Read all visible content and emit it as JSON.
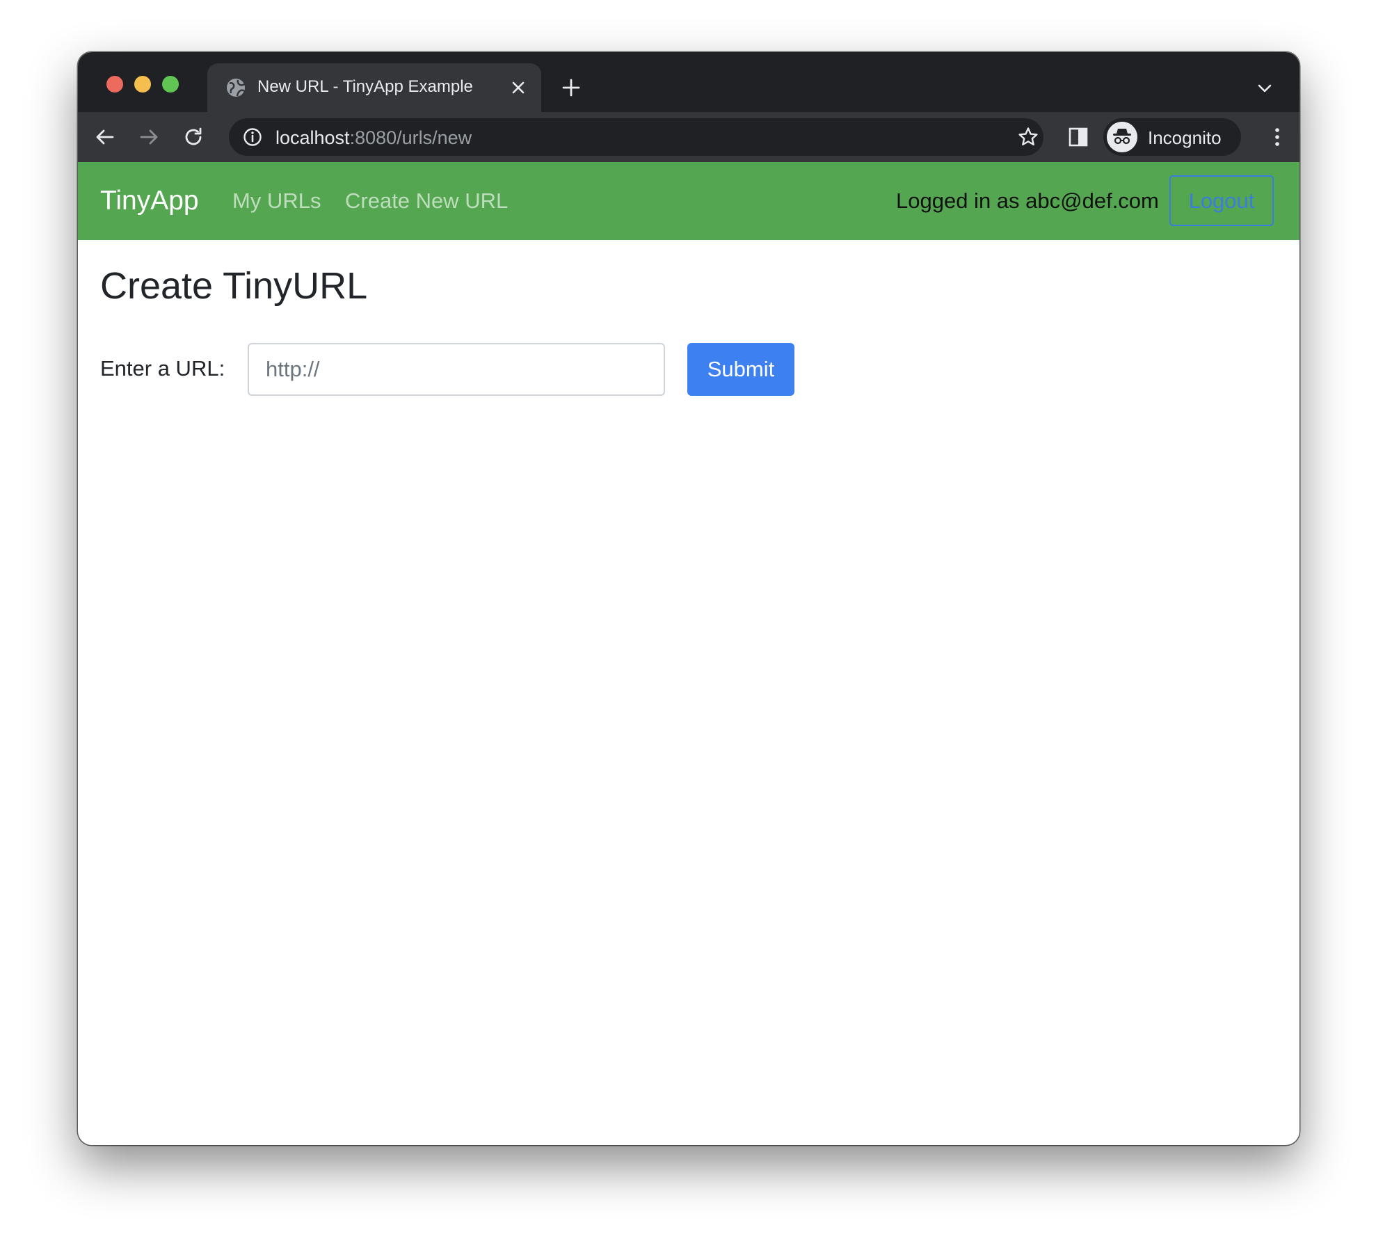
{
  "browser": {
    "tab": {
      "title": "New URL - TinyApp Example"
    },
    "address_bar": {
      "host": "localhost",
      "path": ":8080/urls/new"
    },
    "profile": {
      "label": "Incognito"
    }
  },
  "navbar": {
    "brand": "TinyApp",
    "links": [
      {
        "label": "My URLs"
      },
      {
        "label": "Create New URL"
      }
    ],
    "user_status": "Logged in as abc@def.com",
    "logout_label": "Logout",
    "background_color": "#54a651"
  },
  "main": {
    "title": "Create TinyURL",
    "form": {
      "label": "Enter a URL:",
      "input_placeholder": "http://",
      "input_value": "",
      "submit_label": "Submit",
      "submit_color": "#3d80ef"
    }
  },
  "icons": {
    "tab_favicon": "globe-icon",
    "tab_close": "close-icon",
    "new_tab": "plus-icon",
    "back": "arrow-left-icon",
    "forward": "arrow-right-icon",
    "reload": "reload-icon",
    "site_info": "info-icon",
    "bookmark": "star-icon",
    "side_panel": "side-panel-icon",
    "incognito": "incognito-icon",
    "menu": "kebab-menu-icon",
    "tab_search": "chevron-down-icon"
  }
}
